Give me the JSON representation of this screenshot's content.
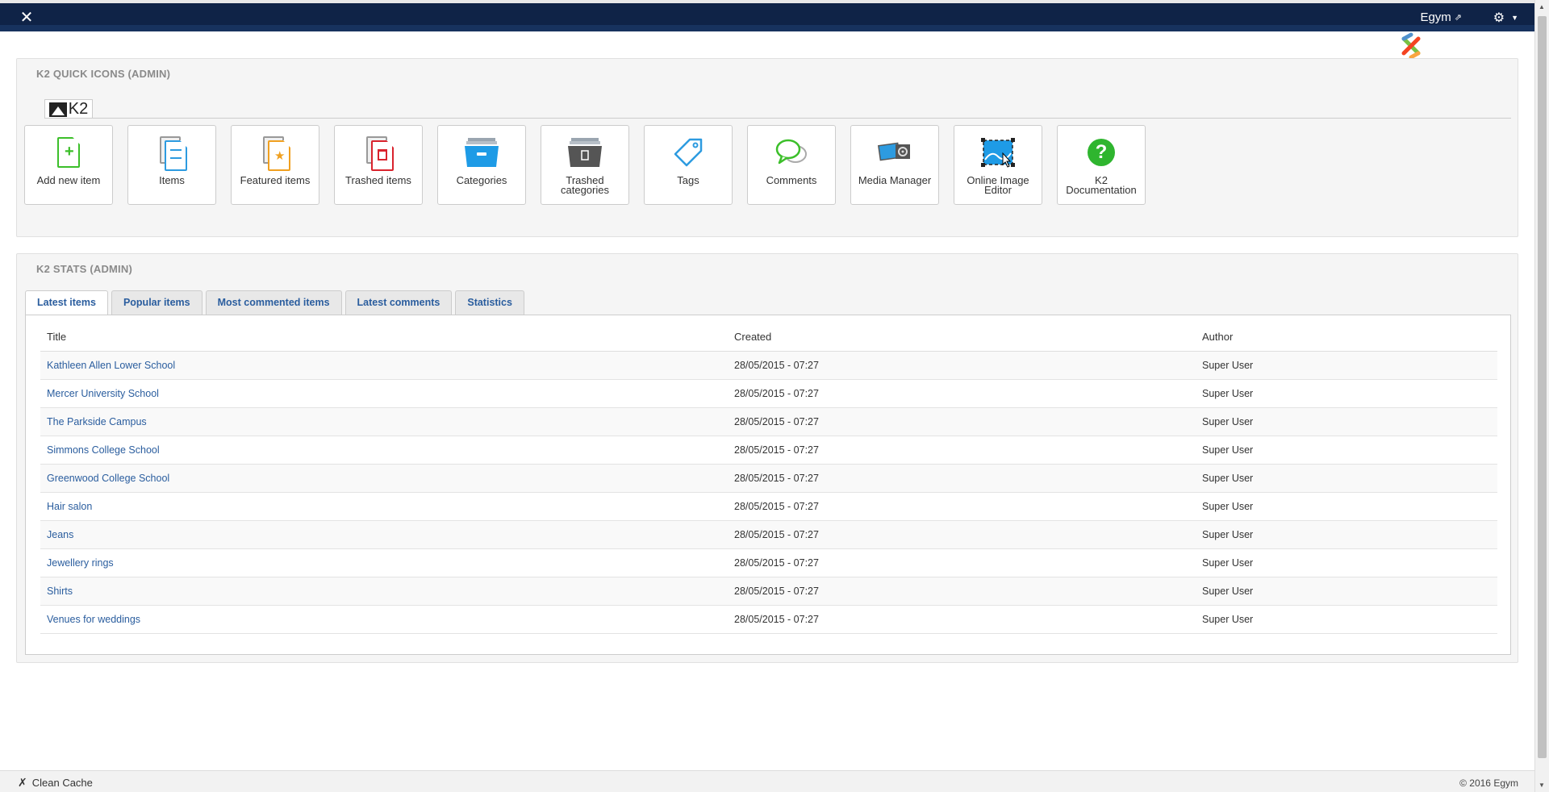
{
  "navbar": {
    "user_label": "Egym",
    "external_icon": "external-link-icon",
    "gear_icon": "gear-icon"
  },
  "quick_icons_panel": {
    "title": "K2 QUICK ICONS (ADMIN)",
    "logo_text": "K2",
    "items": [
      {
        "label": "Add new item",
        "icon": "add-document-icon"
      },
      {
        "label": "Items",
        "icon": "documents-icon"
      },
      {
        "label": "Featured items",
        "icon": "featured-documents-icon"
      },
      {
        "label": "Trashed items",
        "icon": "trashed-documents-icon"
      },
      {
        "label": "Categories",
        "icon": "categories-box-icon"
      },
      {
        "label": "Trashed categories",
        "icon": "trashed-categories-icon"
      },
      {
        "label": "Tags",
        "icon": "tag-icon"
      },
      {
        "label": "Comments",
        "icon": "comments-icon"
      },
      {
        "label": "Media Manager",
        "icon": "media-manager-icon"
      },
      {
        "label": "Online Image Editor",
        "icon": "image-editor-icon"
      },
      {
        "label": "K2 Documentation",
        "icon": "help-icon"
      }
    ]
  },
  "stats_panel": {
    "title": "K2 STATS (ADMIN)",
    "tabs": [
      "Latest items",
      "Popular items",
      "Most commented items",
      "Latest comments",
      "Statistics"
    ],
    "active_tab": "Latest items",
    "columns": [
      "Title",
      "Created",
      "Author"
    ],
    "rows": [
      {
        "title": "Kathleen Allen Lower School",
        "created": "28/05/2015 - 07:27",
        "author": "Super User"
      },
      {
        "title": "Mercer University School",
        "created": "28/05/2015 - 07:27",
        "author": "Super User"
      },
      {
        "title": "The Parkside Campus",
        "created": "28/05/2015 - 07:27",
        "author": "Super User"
      },
      {
        "title": "Simmons College School",
        "created": "28/05/2015 - 07:27",
        "author": "Super User"
      },
      {
        "title": "Greenwood College School",
        "created": "28/05/2015 - 07:27",
        "author": "Super User"
      },
      {
        "title": "Hair salon",
        "created": "28/05/2015 - 07:27",
        "author": "Super User"
      },
      {
        "title": "Jeans",
        "created": "28/05/2015 - 07:27",
        "author": "Super User"
      },
      {
        "title": "Jewellery rings",
        "created": "28/05/2015 - 07:27",
        "author": "Super User"
      },
      {
        "title": "Shirts",
        "created": "28/05/2015 - 07:27",
        "author": "Super User"
      },
      {
        "title": "Venues for weddings",
        "created": "28/05/2015 - 07:27",
        "author": "Super User"
      }
    ]
  },
  "footer": {
    "clean_cache": "Clean Cache",
    "copyright": "© 2016 Egym"
  },
  "colors": {
    "navbar": "#0f2347",
    "link": "#2a5d9e",
    "add_green": "#3cbf2a",
    "items_blue": "#2d9be0",
    "featured_orange": "#f0a020",
    "trash_red": "#d9232d"
  }
}
